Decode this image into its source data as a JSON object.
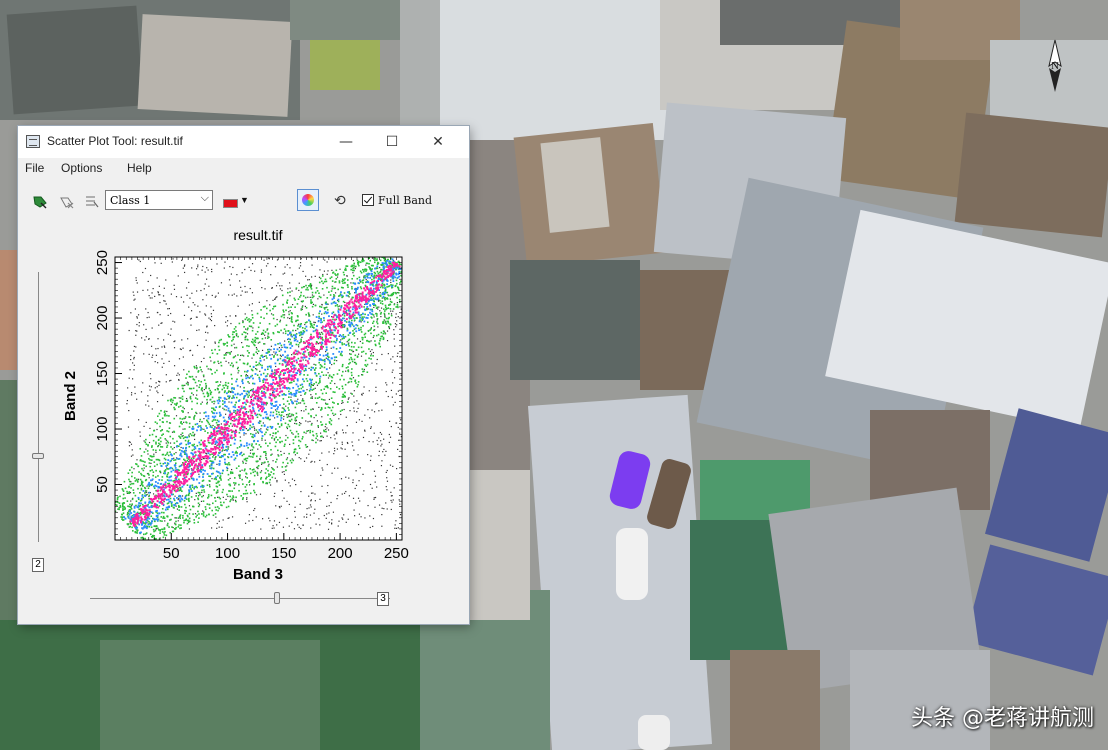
{
  "window": {
    "title": "Scatter Plot Tool: result.tif",
    "minimize_symbol": "—",
    "maximize_symbol": "☐",
    "close_symbol": "✕"
  },
  "menu": [
    {
      "label": "File"
    },
    {
      "label": "Options"
    },
    {
      "label": "Help"
    }
  ],
  "toolbar": {
    "icons": [
      "select-roi-icon",
      "clear-roi-icon",
      "roi-list-icon",
      "density-slice-icon",
      "refresh-icon"
    ],
    "class_select": {
      "value": "Class 1"
    },
    "roi_color": "#e0101a",
    "full_band_label": "Full Band",
    "full_band_checked": true
  },
  "sliders": {
    "vertical_value": "2",
    "horizontal_value": "3"
  },
  "chart_data": {
    "type": "scatter",
    "title": "result.tif",
    "xlabel": "Band 3",
    "ylabel": "Band 2",
    "xlim": [
      0,
      255
    ],
    "ylim": [
      0,
      255
    ],
    "xticks": [
      50,
      100,
      150,
      200,
      250
    ],
    "yticks": [
      50,
      100,
      150,
      200,
      250
    ],
    "description": "density scatter concentrated along diagonal",
    "density_colors": {
      "low": "#2bbf3a",
      "mid": "#2a8cff",
      "high": "#ff1fa0",
      "sparse": "#333333"
    }
  },
  "watermark": "头条 @老蒋讲航测",
  "north_label": "N"
}
